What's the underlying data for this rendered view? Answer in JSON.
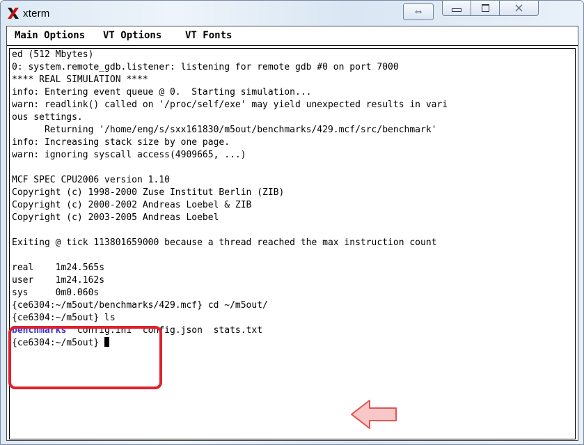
{
  "window": {
    "title": "xterm"
  },
  "menu": {
    "items": [
      "Main Options",
      "VT Options",
      "VT Fonts"
    ]
  },
  "terminal": {
    "lines": [
      "ed (512 Mbytes)",
      "0: system.remote_gdb.listener: listening for remote gdb #0 on port 7000",
      "**** REAL SIMULATION ****",
      "info: Entering event queue @ 0.  Starting simulation...",
      "warn: readlink() called on '/proc/self/exe' may yield unexpected results in vari",
      "ous settings.",
      "      Returning '/home/eng/s/sxx161830/m5out/benchmarks/429.mcf/src/benchmark'",
      "info: Increasing stack size by one page.",
      "warn: ignoring syscall access(4909665, ...)",
      "",
      "MCF SPEC CPU2006 version 1.10",
      "Copyright (c) 1998-2000 Zuse Institut Berlin (ZIB)",
      "Copyright (c) 2000-2002 Andreas Loebel & ZIB",
      "Copyright (c) 2003-2005 Andreas Loebel",
      "",
      "Exiting @ tick 113801659000 because a thread reached the max instruction count",
      "",
      "real    1m24.565s",
      "user    1m24.162s",
      "sys     0m0.060s",
      "{ce6304:~/m5out/benchmarks/429.mcf} cd ~/m5out/",
      "{ce6304:~/m5out} ls"
    ],
    "ls_output": {
      "directory": "benchmarks",
      "files": "  config.ini  config.json  stats.txt"
    },
    "prompt": "{ce6304:~/m5out} "
  },
  "colors": {
    "directory": "#3232e0",
    "highlight_box": "#e0202a",
    "arrow_fill": "#f8c7c7",
    "arrow_stroke": "#e05555"
  }
}
